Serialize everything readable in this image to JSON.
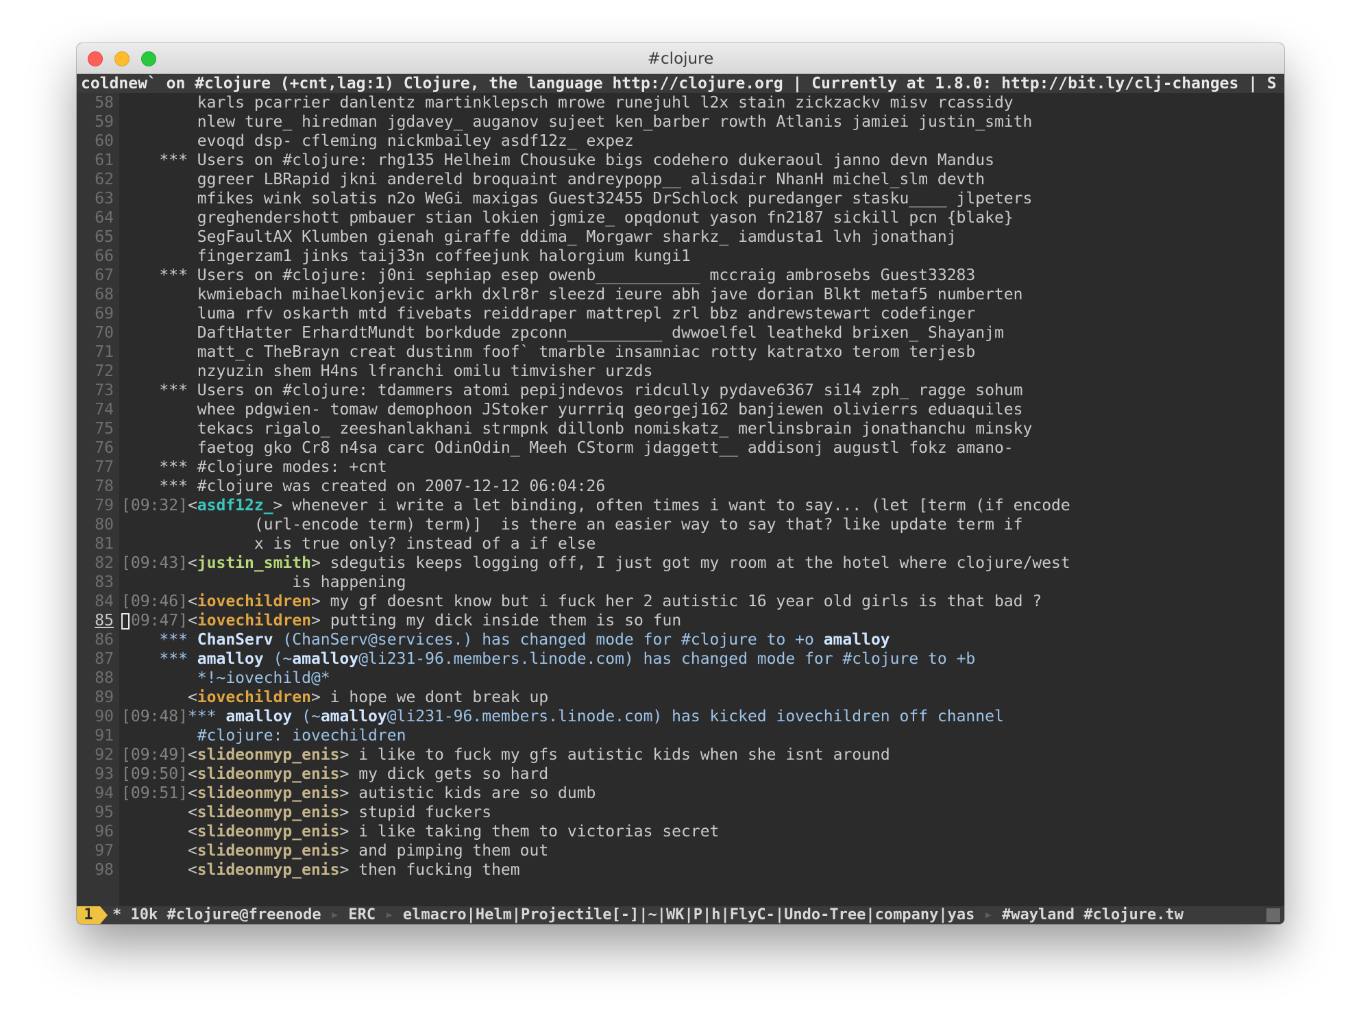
{
  "window": {
    "title": "#clojure"
  },
  "header_line": "coldnew` on #clojure (+cnt,lag:1) Clojure, the language http://clojure.org | Currently at 1.8.0: http://bit.ly/clj-changes | S",
  "buffer": {
    "current_line": 85,
    "lines": [
      {
        "n": 58,
        "kind": "cont",
        "text": "        karls pcarrier danlentz martinklepsch mrowe runejuhl l2x stain zickzackv misv rcassidy"
      },
      {
        "n": 59,
        "kind": "cont",
        "text": "        nlew ture_ hiredman jgdavey_ auganov sujeet ken_barber rowth Atlanis jamiei justin_smith"
      },
      {
        "n": 60,
        "kind": "cont",
        "text": "        evoqd dsp- cfleming nickmbailey asdf12z_ expez"
      },
      {
        "n": 61,
        "kind": "cont",
        "text": "    *** Users on #clojure: rhg135 Helheim Chousuke bigs codehero dukeraoul janno devn Mandus"
      },
      {
        "n": 62,
        "kind": "cont",
        "text": "        ggreer LBRapid jkni andereld broquaint andreypopp__ alisdair NhanH michel_slm devth"
      },
      {
        "n": 63,
        "kind": "cont",
        "text": "        mfikes wink solatis n2o WeGi maxigas Guest32455 DrSchlock puredanger stasku____ jlpeters"
      },
      {
        "n": 64,
        "kind": "cont",
        "text": "        greghendershott pmbauer stian lokien jgmize_ opqdonut yason fn2187 sickill pcn {blake}"
      },
      {
        "n": 65,
        "kind": "cont",
        "text": "        SegFaultAX Klumben gienah giraffe ddima_ Morgawr sharkz_ iamdusta1 lvh jonathanj"
      },
      {
        "n": 66,
        "kind": "cont",
        "text": "        fingerzam1 jinks taij33n coffeejunk halorgium kungi1"
      },
      {
        "n": 67,
        "kind": "cont",
        "text": "    *** Users on #clojure: j0ni sephiap esep owenb___________ mccraig ambrosebs Guest33283"
      },
      {
        "n": 68,
        "kind": "cont",
        "text": "        kwmiebach mihaelkonjevic arkh dxlr8r sleezd ieure abh jave dorian Blkt metaf5 numberten"
      },
      {
        "n": 69,
        "kind": "cont",
        "text": "        luma rfv oskarth mtd fivebats reiddraper mattrepl zrl bbz andrewstewart codefinger"
      },
      {
        "n": 70,
        "kind": "cont",
        "text": "        DaftHatter ErhardtMundt borkdude zpconn__________ dwwoelfel leathekd brixen_ Shayanjm"
      },
      {
        "n": 71,
        "kind": "cont",
        "text": "        matt_c TheBrayn creat dustinm foof` tmarble insamniac rotty katratxo terom terjesb"
      },
      {
        "n": 72,
        "kind": "cont",
        "text": "        nzyuzin shem H4ns lfranchi omilu timvisher urzds"
      },
      {
        "n": 73,
        "kind": "cont",
        "text": "    *** Users on #clojure: tdammers atomi pepijndevos ridcully pydave6367 si14 zph_ ragge sohum"
      },
      {
        "n": 74,
        "kind": "cont",
        "text": "        whee pdgwien- tomaw demophoon JStoker yurrriq georgej162 banjiewen olivierrs eduaquiles"
      },
      {
        "n": 75,
        "kind": "cont",
        "text": "        tekacs rigalo_ zeeshanlakhani strmpnk dillonb nomiskatz_ merlinsbrain jonathanchu minsky"
      },
      {
        "n": 76,
        "kind": "cont",
        "text": "        faetog gko Cr8 n4sa carc OdinOdin_ Meeh CStorm jdaggett__ addisonj augustl fokz amano-"
      },
      {
        "n": 77,
        "kind": "cont",
        "text": "    *** #clojure modes: +cnt"
      },
      {
        "n": 78,
        "kind": "cont",
        "text": "    *** #clojure was created on 2007-12-12 06:04:26"
      },
      {
        "n": 79,
        "kind": "msg",
        "ts": "[09:32]",
        "nick": "asdf12z_",
        "nick_class": "nick-asdf",
        "text": " whenever i write a let binding, often times i want to say... (let [term (if encode"
      },
      {
        "n": 80,
        "kind": "cont",
        "text": "              (url-encode term) term)]  is there an easier way to say that? like update term if"
      },
      {
        "n": 81,
        "kind": "cont",
        "text": "              x is true only? instead of a if else"
      },
      {
        "n": 82,
        "kind": "msg",
        "ts": "[09:43]",
        "nick": "justin_smith",
        "nick_class": "nick-justin",
        "text": " sdegutis keeps logging off, I just got my room at the hotel where clojure/west"
      },
      {
        "n": 83,
        "kind": "cont",
        "text": "                  is happening"
      },
      {
        "n": 84,
        "kind": "msg",
        "ts": "[09:46]",
        "nick": "iovechildren",
        "nick_class": "nick-iove",
        "text": " my gf doesnt know but i fuck her 2 autistic 16 year old girls is that bad ?"
      },
      {
        "n": 85,
        "kind": "msg",
        "ts": "[09:47]",
        "nick": "iovechildren",
        "nick_class": "nick-iove",
        "text": " putting my dick inside them is so fun",
        "cursor": true
      },
      {
        "n": 86,
        "kind": "notice",
        "bold": "ChanServ",
        "text": " (ChanServ@services.) has changed mode for #clojure to +o ",
        "bold2": "amalloy"
      },
      {
        "n": 87,
        "kind": "notice",
        "bold": "amalloy",
        "text": " (~",
        "bold2": "amalloy",
        "text2": "@li231-96.members.linode.com) has changed mode for #clojure to +b"
      },
      {
        "n": 88,
        "kind": "ncont",
        "text": "        *!~iovechild@*"
      },
      {
        "n": 89,
        "kind": "msg",
        "ts": "",
        "nick": "iovechildren",
        "nick_class": "nick-iove",
        "text": " i hope we dont break up"
      },
      {
        "n": 90,
        "kind": "notice",
        "ts": "[09:48]",
        "bold": "amalloy",
        "text": " (~",
        "bold2": "amalloy",
        "text2": "@li231-96.members.linode.com) has kicked iovechildren off channel"
      },
      {
        "n": 91,
        "kind": "ncont",
        "text": "        #clojure: iovechildren"
      },
      {
        "n": 92,
        "kind": "msg",
        "ts": "[09:49]",
        "nick": "slideonmyp_enis",
        "nick_class": "nick-slide",
        "text": " i like to fuck my gfs autistic kids when she isnt around"
      },
      {
        "n": 93,
        "kind": "msg",
        "ts": "[09:50]",
        "nick": "slideonmyp_enis",
        "nick_class": "nick-slide",
        "text": " my dick gets so hard"
      },
      {
        "n": 94,
        "kind": "msg",
        "ts": "[09:51]",
        "nick": "slideonmyp_enis",
        "nick_class": "nick-slide",
        "text": " autistic kids are so dumb"
      },
      {
        "n": 95,
        "kind": "msg",
        "ts": "",
        "nick": "slideonmyp_enis",
        "nick_class": "nick-slide",
        "text": " stupid fuckers"
      },
      {
        "n": 96,
        "kind": "msg",
        "ts": "",
        "nick": "slideonmyp_enis",
        "nick_class": "nick-slide",
        "text": " i like taking them to victorias secret"
      },
      {
        "n": 97,
        "kind": "msg",
        "ts": "",
        "nick": "slideonmyp_enis",
        "nick_class": "nick-slide",
        "text": " and pimping them out"
      },
      {
        "n": 98,
        "kind": "msg",
        "ts": "",
        "nick": "slideonmyp_enis",
        "nick_class": "nick-slide",
        "text": " then fucking them"
      }
    ]
  },
  "modeline": {
    "window_number": "1",
    "buffer_info": "* 10k #clojure@freenode ",
    "major_mode": " ERC ",
    "minor_modes": " elmacro|Helm|Projectile[-]|~|WK|P|h|FlyC-|Undo-Tree|company|yas ",
    "tracking": " #wayland #clojure.tw"
  },
  "colors": {
    "background": "#2b2b2b",
    "accent": "#f0c243",
    "nick_asdf": "#3ac7c0",
    "nick_justin": "#b6d87a",
    "nick_iove": "#e0a441",
    "nick_slide": "#c7b58a",
    "notice": "#9cc3e8"
  }
}
